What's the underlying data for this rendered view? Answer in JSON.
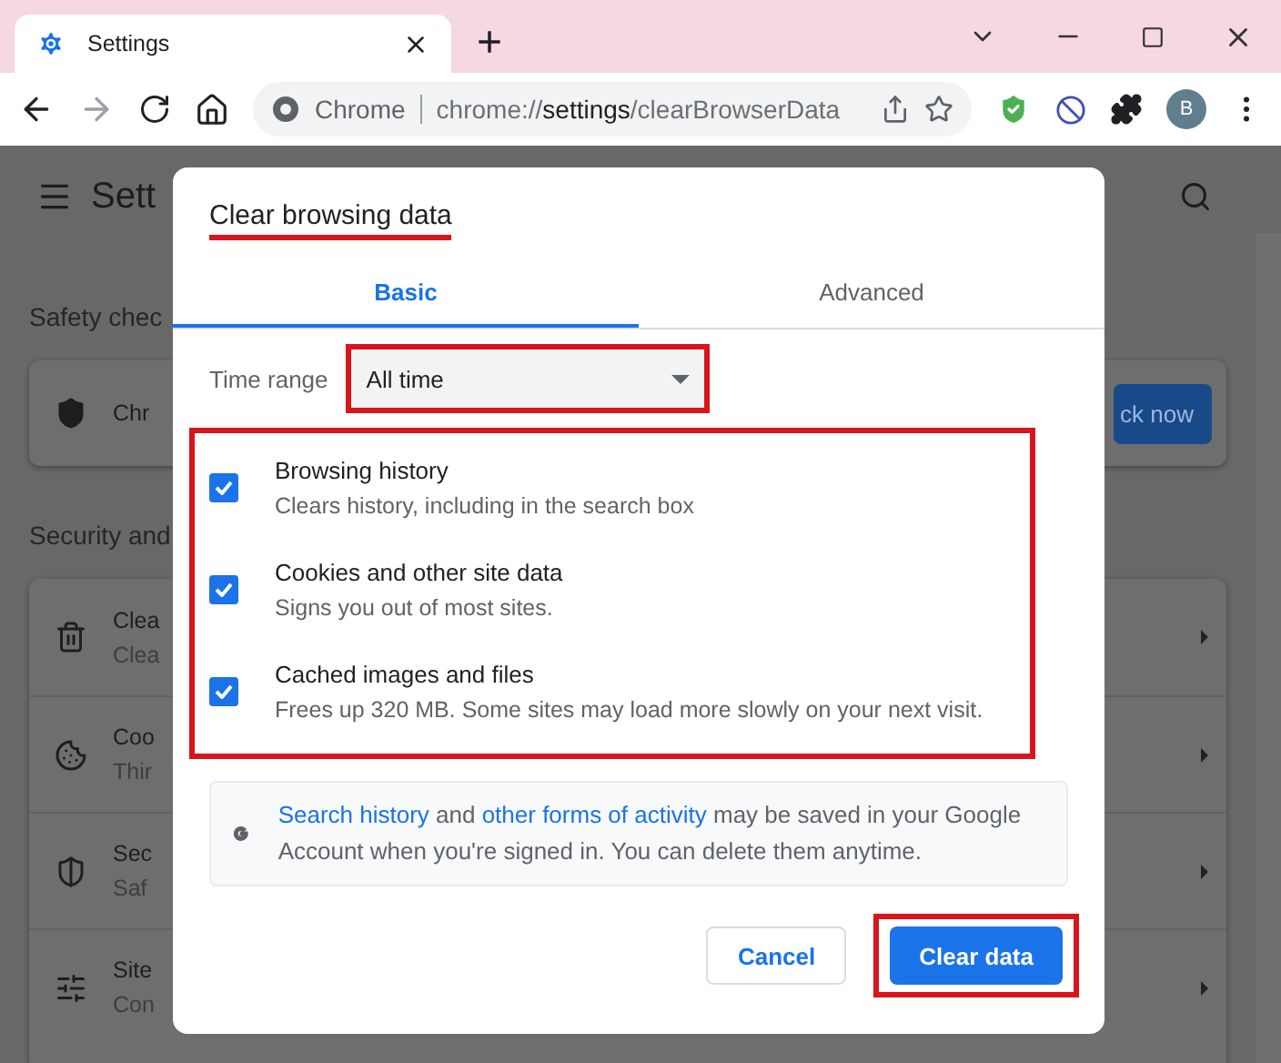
{
  "browser": {
    "tab": {
      "title": "Settings",
      "selected": true
    },
    "new_tab": "+",
    "address": {
      "chip": "Chrome",
      "url_parts": [
        {
          "text": "chrome://",
          "strong": false
        },
        {
          "text": "settings",
          "strong": true
        },
        {
          "text": "/clearBrowserData",
          "strong": false
        }
      ]
    },
    "profile_initial": "B"
  },
  "settings_page": {
    "title": "Sett",
    "safety_heading": "Safety chec",
    "safety_item": "Chr",
    "safety_button": "ck now",
    "security_heading": "Security and",
    "rows": [
      {
        "kind": "trash",
        "title": "Clea",
        "subtitle": "Clea"
      },
      {
        "kind": "cookie",
        "title": "Coo",
        "subtitle": "Thir"
      },
      {
        "kind": "shield",
        "title": "Sec",
        "subtitle": "Saf"
      },
      {
        "kind": "sliders",
        "title": "Site",
        "subtitle": "Con"
      }
    ]
  },
  "dialog": {
    "title": "Clear browsing data",
    "title_highlighted": true,
    "tabs": [
      {
        "label": "Basic",
        "selected": true
      },
      {
        "label": "Advanced",
        "selected": false
      }
    ],
    "time_range": {
      "label": "Time range",
      "value": "All time",
      "highlighted": true
    },
    "options_highlighted": true,
    "options": [
      {
        "title": "Browsing history",
        "description": "Clears history, including in the search box",
        "checked": true
      },
      {
        "title": "Cookies and other site data",
        "description": "Signs you out of most sites.",
        "checked": true
      },
      {
        "title": "Cached images and files",
        "description": "Frees up 320 MB. Some sites may load more slowly on your next visit.",
        "checked": true
      }
    ],
    "notice": [
      {
        "text": "Search history",
        "link": true
      },
      {
        "text": " and ",
        "link": false
      },
      {
        "text": "other forms of activity",
        "link": true
      },
      {
        "text": " may be saved in your Google Account when you're signed in. You can delete them anytime.",
        "link": false
      }
    ],
    "buttons": [
      {
        "label": "Cancel",
        "kind": "secondary",
        "highlighted": false
      },
      {
        "label": "Clear data",
        "kind": "primary",
        "highlighted": true
      }
    ]
  }
}
